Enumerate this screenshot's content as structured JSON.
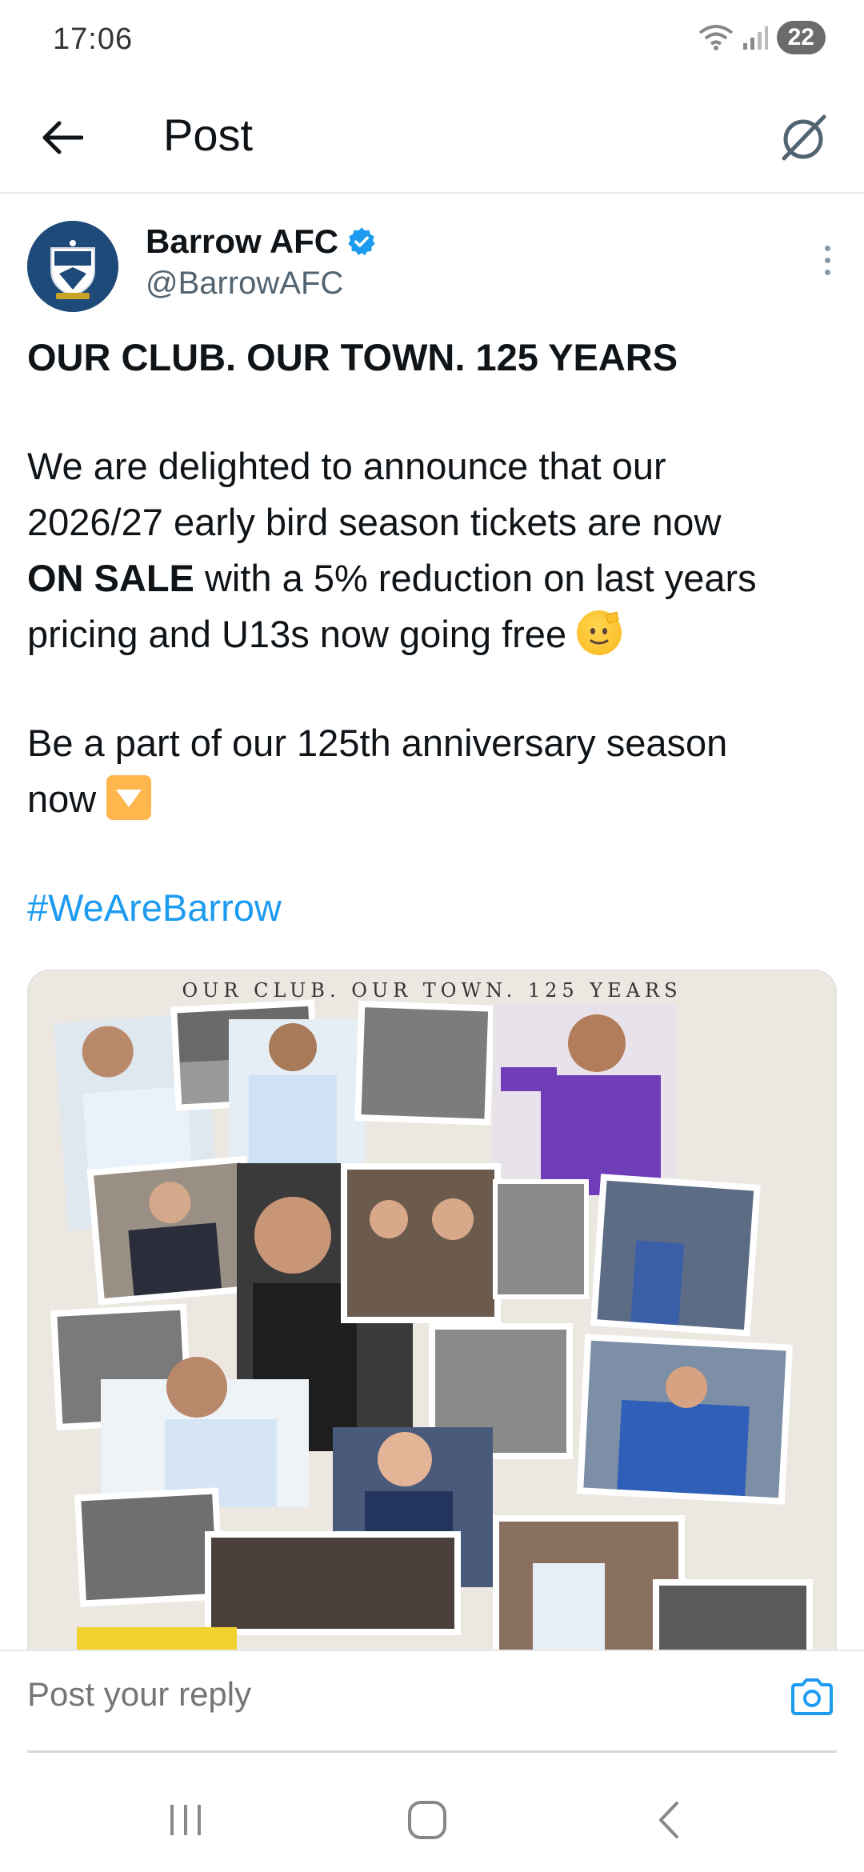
{
  "status_bar": {
    "time": "17:06",
    "battery": "22"
  },
  "header": {
    "title": "Post",
    "back_icon": "arrow-left-icon",
    "grok_icon": "grok-icon"
  },
  "author": {
    "display_name": "Barrow AFC",
    "handle": "@BarrowAFC",
    "verified": true
  },
  "post": {
    "headline": "OUR CLUB. OUR TOWN. 125 YEARS",
    "para1_line1": "We are delighted to announce that our",
    "para1_line2": "2026/27 early bird season tickets are now",
    "para1_bold": "ON SALE",
    "para1_line3_rest": " with a 5% reduction on last years",
    "para1_line4": "pricing and U13s now going free ",
    "para2_line1": "Be a part of our 125th anniversary season",
    "para2_line2": "now ",
    "hashtag": "#WeAreBarrow"
  },
  "media": {
    "banner_text": "OUR CLUB. OUR TOWN. 125 YEARS"
  },
  "reply": {
    "placeholder": "Post your reply"
  },
  "colors": {
    "accent": "#1d9bf0",
    "verified": "#1d9bf0",
    "secondary_text": "#536471"
  }
}
